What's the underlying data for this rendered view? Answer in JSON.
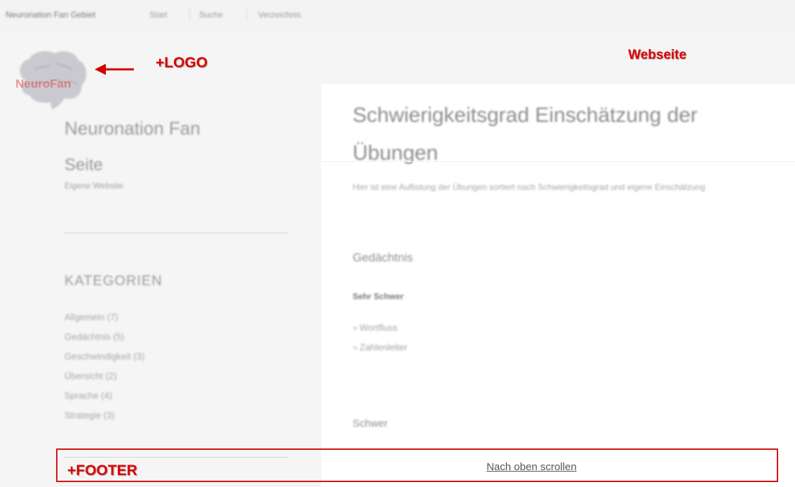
{
  "header": {
    "site_title": "Neuronation Fan Gebiet",
    "nav": [
      "Start",
      "Suche",
      "Verzeichnis"
    ]
  },
  "logo": {
    "text": "NeuroFan"
  },
  "sidebar": {
    "name": "Neuronation Fan",
    "seite": "Seite",
    "tagline": "Eigene Website",
    "categories_title": "KATEGORIEN",
    "categories": [
      "Allgemein (7)",
      "Gedächtnis (5)",
      "Geschwindigkeit (3)",
      "Übersicht (2)",
      "Sprache (4)",
      "Strategie (3)"
    ]
  },
  "main": {
    "title": "Schwierigkeitsgrad Einschätzung der Übungen",
    "intro": "Hier ist eine Auflistung der Übungen sortiert nach Schwierigkeitsgrad und eigene Einschätzung",
    "section1": "Gedächtnis",
    "subsection1": "Sehr Schwer",
    "items": [
      "Wortfluss",
      "Zahlenleiter"
    ],
    "section2": "Schwer"
  },
  "annotations": {
    "logo": "+LOGO",
    "webseite": "Webseite",
    "footer": "+FOOTER"
  },
  "footer": {
    "scroll_top": "Nach oben scrollen"
  },
  "colors": {
    "annotation": "#e00000",
    "footer_box": "#d41515"
  }
}
